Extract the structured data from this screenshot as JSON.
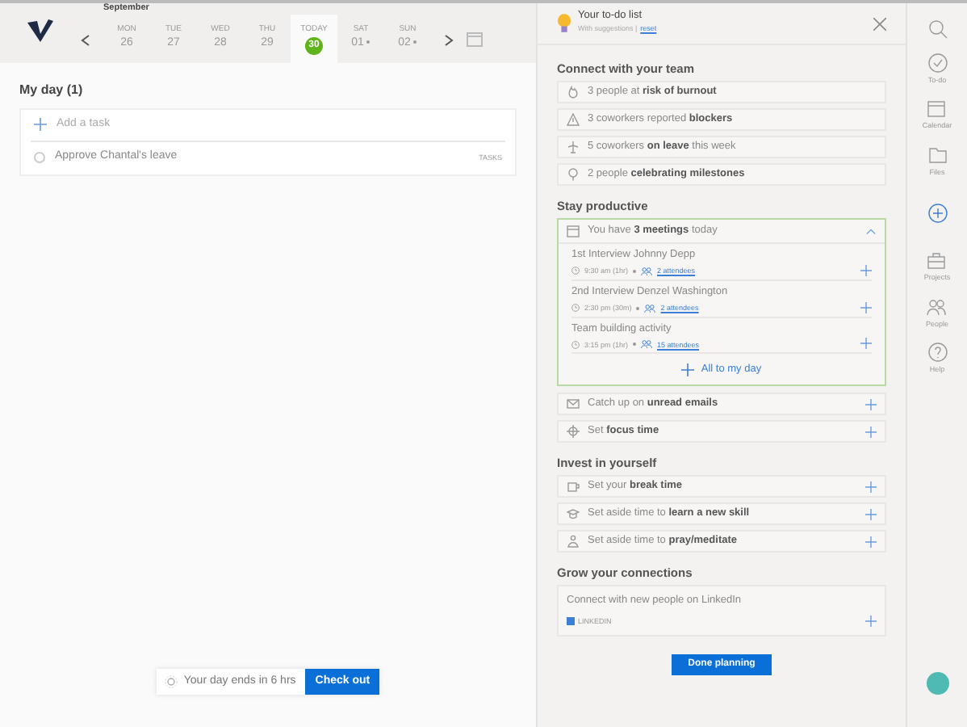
{
  "calendar": {
    "month": "September",
    "days": [
      {
        "dow": "MON",
        "date": "26",
        "selected": false,
        "marked": false
      },
      {
        "dow": "TUE",
        "date": "27",
        "selected": false,
        "marked": false
      },
      {
        "dow": "WED",
        "date": "28",
        "selected": false,
        "marked": false
      },
      {
        "dow": "THU",
        "date": "29",
        "selected": false,
        "marked": false
      },
      {
        "dow": "TODAY",
        "date": "30",
        "selected": true,
        "marked": false
      },
      {
        "dow": "SAT",
        "date": "01",
        "selected": false,
        "marked": true
      },
      {
        "dow": "SUN",
        "date": "02",
        "selected": false,
        "marked": true
      }
    ]
  },
  "my_day": {
    "title": "My day (1)",
    "add_placeholder": "Add a task",
    "tasks": [
      {
        "label": "Approve Chantal's leave",
        "source": "TASKS",
        "checked": false
      }
    ]
  },
  "day_footer": {
    "text": "Your day ends in 6 hrs",
    "button": "Check out"
  },
  "panel": {
    "title": "Your to-do list",
    "subtitle": "With suggestions |",
    "reset": "reset",
    "sections": [
      {
        "heading": "Connect with your team",
        "items": [
          {
            "kind": "info",
            "text": "3 people at **risk of burnout**"
          },
          {
            "kind": "info",
            "text": "3 coworkers reported **blockers**"
          },
          {
            "kind": "info",
            "text": "5 coworkers **on leave** this week"
          },
          {
            "kind": "info",
            "text": "2 people **celebrating milestones**"
          }
        ]
      },
      {
        "heading": "Stay productive",
        "items": [
          {
            "kind": "meetings",
            "text": "You have **3 meetings** today",
            "expanded": true,
            "action": "All to my day",
            "meetings": [
              {
                "title": "1st Interview Johnny Depp",
                "time": "9:30 am (1hr)",
                "attendees": "2 attendees"
              },
              {
                "title": "2nd Interview Denzel Washington",
                "time": "2:30 pm (30m)",
                "attendees": "2 attendees"
              },
              {
                "title": "Team building activity",
                "time": "3:15 pm (1hr)",
                "attendees": "15 attendees"
              }
            ]
          },
          {
            "kind": "addable",
            "text": "Catch up on **unread emails**"
          },
          {
            "kind": "addable",
            "text": "Set **focus time**"
          }
        ]
      },
      {
        "heading": "Invest in yourself",
        "items": [
          {
            "kind": "addable",
            "text": "Set your **break time**"
          },
          {
            "kind": "addable",
            "text": "Set aside time to **learn a new skill**"
          },
          {
            "kind": "addable",
            "text": "Set aside time to **pray/meditate**"
          }
        ]
      },
      {
        "heading": "Grow your connections",
        "items": [
          {
            "kind": "source",
            "text": "Connect with new people on LinkedIn",
            "source": "LINKEDIN"
          }
        ]
      }
    ],
    "done": "Done planning"
  },
  "nav": [
    {
      "kind": "search"
    },
    {
      "kind": "labeled",
      "label": "To-do"
    },
    {
      "kind": "labeled",
      "label": "Calendar"
    },
    {
      "kind": "labeled",
      "label": "Files"
    },
    {
      "kind": "add"
    },
    {
      "kind": "labeled",
      "label": "Projects"
    },
    {
      "kind": "labeled",
      "label": "People"
    },
    {
      "kind": "labeled",
      "label": "Help"
    }
  ]
}
